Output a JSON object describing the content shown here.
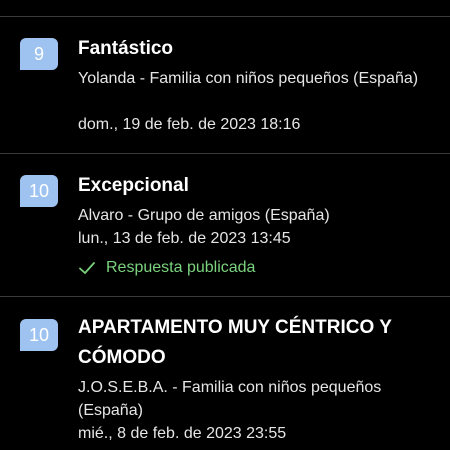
{
  "reviews": [
    {
      "score": "9",
      "title": "Fantástico",
      "guest": "Yolanda - Familia con niños pequeños (España)",
      "date": "dom., 19 de feb. de 2023 18:16"
    },
    {
      "score": "10",
      "title": "Excepcional",
      "guest": "Alvaro - Grupo de amigos (España)",
      "date": "lun., 13 de feb. de 2023 13:45",
      "reply_status": "Respuesta publicada"
    },
    {
      "score": "10",
      "title": "APARTAMENTO MUY CÉNTRICO Y CÓMODO",
      "guest": "J.O.S.E.B.A. - Familia con niños pequeños (España)",
      "date": "mié., 8 de feb. de 2023 23:55"
    }
  ],
  "colors": {
    "background": "#000000",
    "score_badge": "#9fc3f0",
    "divider": "#3a3a3c",
    "reply_published": "#7bd37e"
  }
}
